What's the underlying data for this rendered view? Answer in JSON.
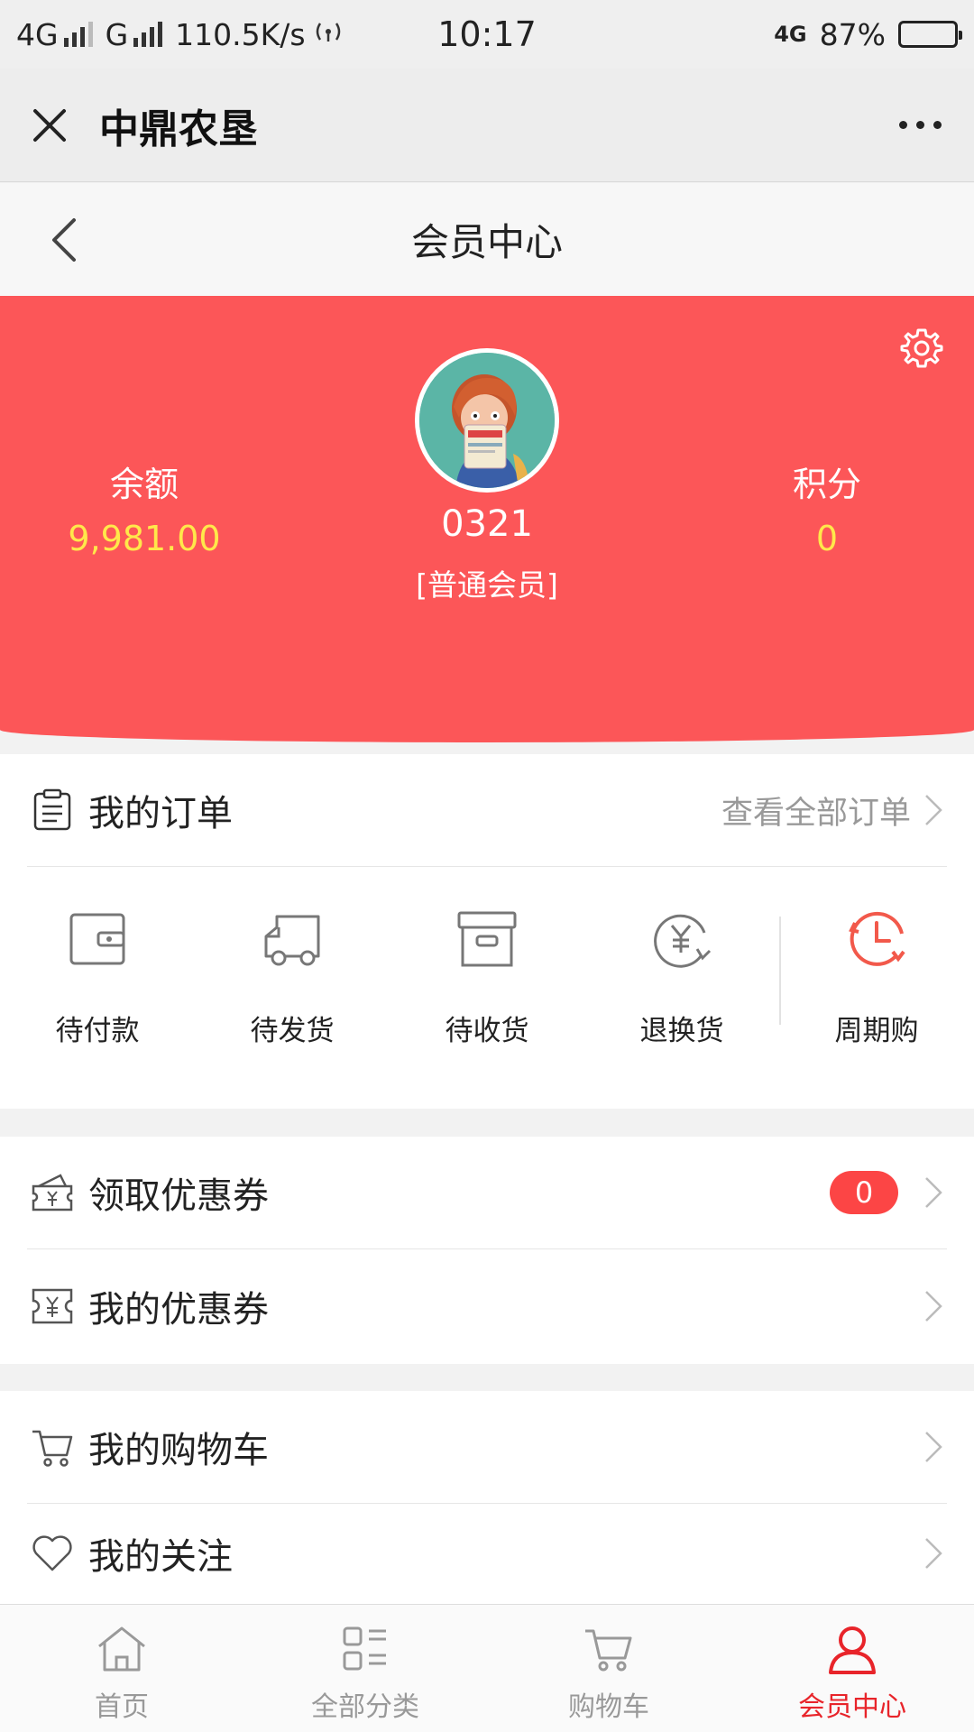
{
  "status_bar": {
    "network1": "4G",
    "network2": "G",
    "speed": "110.5K/s",
    "time": "10:17",
    "net_badge": "4G",
    "battery_text": "87%",
    "battery_level": 0.87
  },
  "titlebar": {
    "title": "中鼎农垦"
  },
  "page": {
    "title": "会员中心"
  },
  "member": {
    "balance_label": "余额",
    "balance_value": "9,981.00",
    "points_label": "积分",
    "points_value": "0",
    "username": "0321",
    "level": "[普通会员]"
  },
  "orders": {
    "title": "我的订单",
    "view_all": "查看全部订单",
    "items": [
      {
        "label": "待付款",
        "icon": "wallet-icon"
      },
      {
        "label": "待发货",
        "icon": "truck-icon"
      },
      {
        "label": "待收货",
        "icon": "box-icon"
      },
      {
        "label": "退换货",
        "icon": "refund-icon"
      },
      {
        "label": "周期购",
        "icon": "clock-icon"
      }
    ]
  },
  "coupons": {
    "claim_label": "领取优惠券",
    "claim_count": "0",
    "mine_label": "我的优惠券"
  },
  "more": {
    "cart_label": "我的购物车",
    "follow_label": "我的关注"
  },
  "tabbar": [
    {
      "label": "首页",
      "icon": "home-icon",
      "active": false
    },
    {
      "label": "全部分类",
      "icon": "category-icon",
      "active": false
    },
    {
      "label": "购物车",
      "icon": "cart-icon",
      "active": false
    },
    {
      "label": "会员中心",
      "icon": "user-icon",
      "active": true
    }
  ],
  "colors": {
    "header_red": "#fc5658",
    "value_yellow": "#ffe84a",
    "active_red": "#e8242a",
    "clock_red": "#f2594b"
  }
}
